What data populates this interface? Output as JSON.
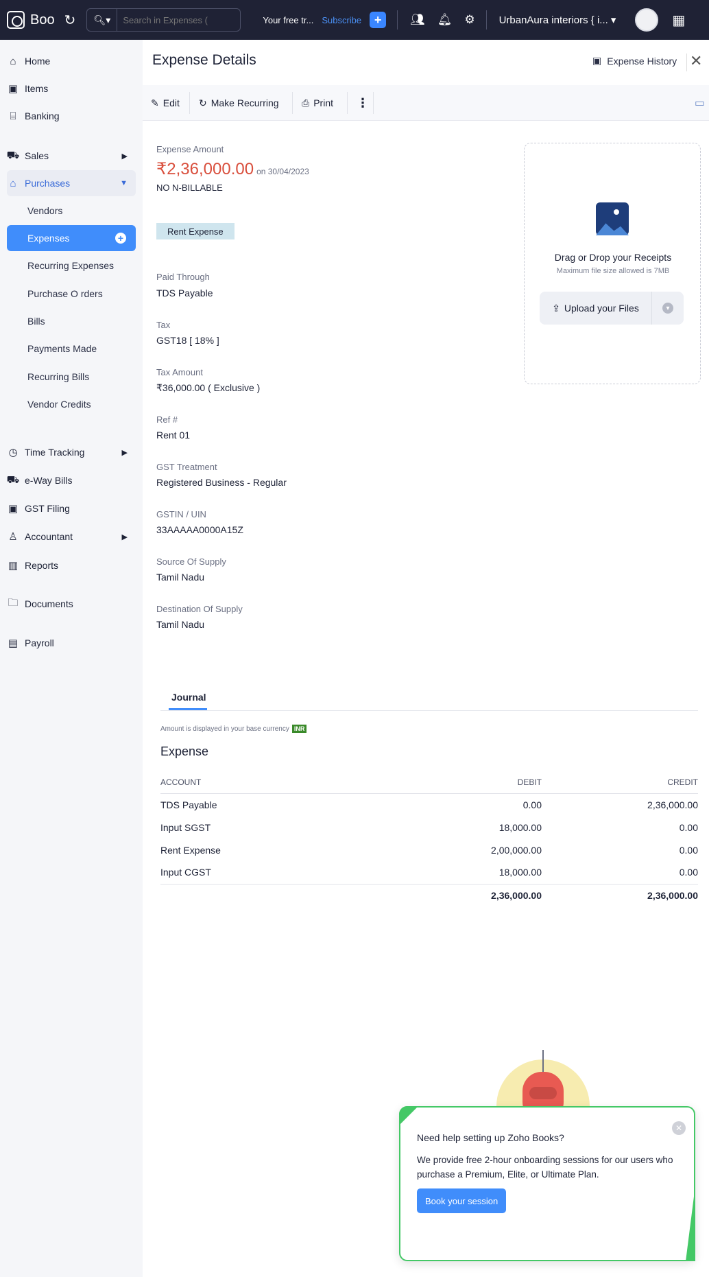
{
  "topbar": {
    "app_name": "Boo",
    "search_placeholder": "Search in Expenses (",
    "trial_text": "Your free tr...",
    "subscribe_label": "Subscribe",
    "org_name": "UrbanAura interiors { i..."
  },
  "sidebar": {
    "items": [
      {
        "label": "Home",
        "icon": "home-icon"
      },
      {
        "label": "Items",
        "icon": "items-icon"
      },
      {
        "label": "Banking",
        "icon": "bank-icon"
      },
      {
        "label": "Sales",
        "icon": "cart-icon"
      },
      {
        "label": "Purchases",
        "icon": "bag-icon"
      },
      {
        "label": "Time Tracking",
        "icon": "clock-icon"
      },
      {
        "label": "e-Way Bills",
        "icon": "truck-icon"
      },
      {
        "label": "GST Filing",
        "icon": "gst-icon"
      },
      {
        "label": "Accountant",
        "icon": "accountant-icon"
      },
      {
        "label": "Reports",
        "icon": "reports-icon"
      },
      {
        "label": "Documents",
        "icon": "folder-icon"
      },
      {
        "label": "Payroll",
        "icon": "payroll-icon"
      }
    ],
    "purchases_sub": [
      {
        "label": "Vendors"
      },
      {
        "label": "Expenses"
      },
      {
        "label": "Recurring Expenses"
      },
      {
        "label": "Purchase O rders"
      },
      {
        "label": "Bills"
      },
      {
        "label": "Payments Made"
      },
      {
        "label": "Recurring Bills"
      },
      {
        "label": "Vendor Credits"
      }
    ]
  },
  "header": {
    "title": "Expense Details",
    "history_label": "Expense History"
  },
  "toolbar": {
    "edit_label": "Edit",
    "recurring_label": "Make Recurring",
    "print_label": "Print"
  },
  "details": {
    "amount_label": "Expense Amount",
    "amount": "₹2,36,000.00",
    "date_text": "on 30/04/2023",
    "billable": "NO N-BILLABLE",
    "category_tag": "Rent Expense",
    "paid_through_label": "Paid Through",
    "paid_through": "TDS Payable",
    "tax_label": "Tax",
    "tax": "GST18 [ 18% ]",
    "tax_amount_label": "Tax Amount",
    "tax_amount": "₹36,000.00 ( Exclusive )",
    "ref_label": "Ref #",
    "ref": "Rent 01",
    "gst_treatment_label": "GST Treatment",
    "gst_treatment": "Registered Business - Regular",
    "gstin_label": "GSTIN / UIN",
    "gstin": "33AAAAA0000A15Z",
    "source_label": "Source Of Supply",
    "source": "Tamil Nadu",
    "destination_label": "Destination Of Supply",
    "destination": "Tamil Nadu"
  },
  "receipts": {
    "title": "Drag or Drop your Receipts",
    "subtitle": "Maximum file size allowed is 7MB",
    "upload_label": "Upload your Files"
  },
  "journal": {
    "tab_label": "Journal",
    "currency_note": "Amount is displayed in your base currency",
    "currency": "INR",
    "heading": "Expense",
    "columns": [
      "ACCOUNT",
      "DEBIT",
      "CREDIT"
    ],
    "rows": [
      {
        "account": "TDS Payable",
        "debit": "0.00",
        "credit": "2,36,000.00"
      },
      {
        "account": "Input SGST",
        "debit": "18,000.00",
        "credit": "0.00"
      },
      {
        "account": "Rent Expense",
        "debit": "2,00,000.00",
        "credit": "0.00"
      },
      {
        "account": "Input CGST",
        "debit": "18,000.00",
        "credit": "0.00"
      }
    ],
    "total_debit": "2,36,000.00",
    "total_credit": "2,36,000.00"
  },
  "help": {
    "title": "Need help setting up Zoho Books?",
    "body": "We provide free 2-hour onboarding sessions for our users who purchase a Premium, Elite, or Ultimate Plan.",
    "button": "Book your session"
  },
  "colors": {
    "topbar": "#1f2235",
    "accent": "#408dfb",
    "amount": "#d94f3d",
    "help_border": "#44c866"
  }
}
